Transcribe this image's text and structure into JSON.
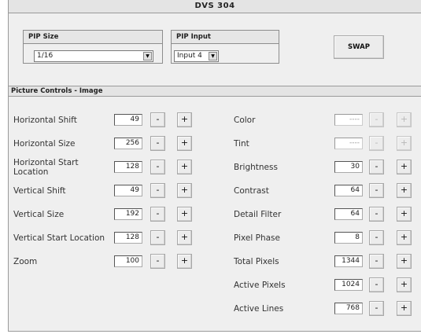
{
  "window": {
    "title": "DVS 304"
  },
  "pip_size": {
    "label": "PIP Size",
    "selected": "1/16"
  },
  "pip_input": {
    "label": "PIP Input",
    "selected": "Input 4"
  },
  "swap_button": {
    "label": "SWAP"
  },
  "section": {
    "title": "Picture Controls - Image"
  },
  "minus_label": "-",
  "plus_label": "+",
  "left_controls": [
    {
      "label": "Horizontal Shift",
      "value": "49"
    },
    {
      "label": "Horizontal Size",
      "value": "256"
    },
    {
      "label": "Horizontal Start Location",
      "value": "128"
    },
    {
      "label": "Vertical Shift",
      "value": "49"
    },
    {
      "label": "Vertical Size",
      "value": "192"
    },
    {
      "label": "Vertical Start Location",
      "value": "128"
    },
    {
      "label": "Zoom",
      "value": "100"
    }
  ],
  "right_controls": [
    {
      "label": "Color",
      "value": "----",
      "enabled": false
    },
    {
      "label": "Tint",
      "value": "----",
      "enabled": false
    },
    {
      "label": "Brightness",
      "value": "30",
      "enabled": true
    },
    {
      "label": "Contrast",
      "value": "64",
      "enabled": true
    },
    {
      "label": "Detail Filter",
      "value": "64",
      "enabled": true
    },
    {
      "label": "Pixel Phase",
      "value": "8",
      "enabled": true
    },
    {
      "label": "Total Pixels",
      "value": "1344",
      "enabled": true
    },
    {
      "label": "Active Pixels",
      "value": "1024",
      "enabled": true
    },
    {
      "label": "Active Lines",
      "value": "768",
      "enabled": true
    }
  ]
}
